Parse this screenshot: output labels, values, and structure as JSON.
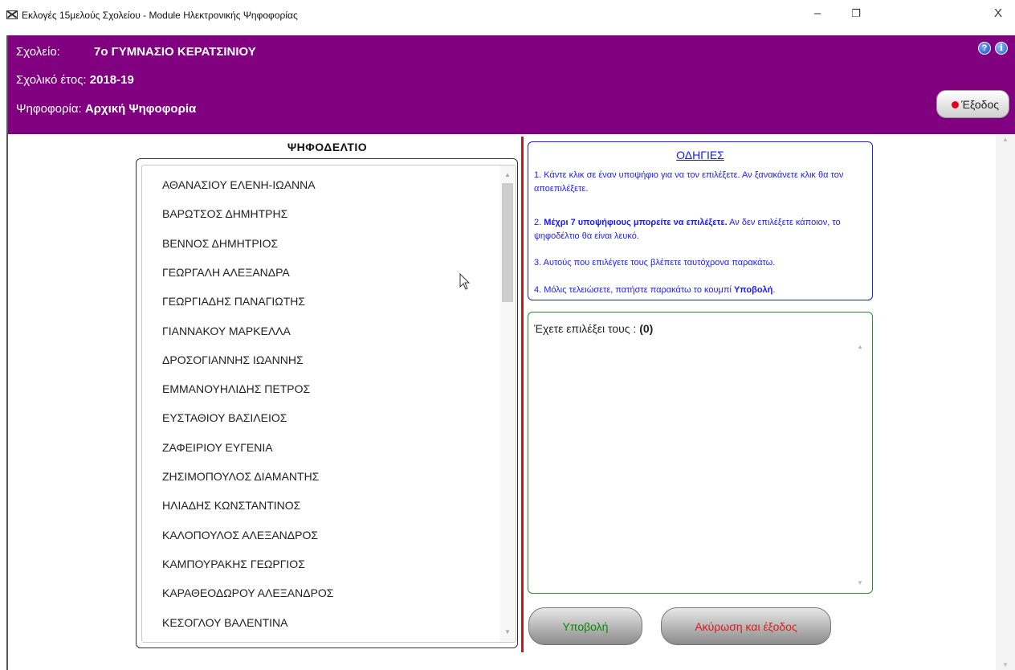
{
  "window": {
    "title": "Εκλογές 15μελούς Σχολείου - Module Ηλεκτρονικής Ψηφοφορίας",
    "minimize": "–",
    "maximize": "❐",
    "close": "X"
  },
  "header": {
    "school_label": "Σχολείο:",
    "school_value": "7ο ΓΥΜΝΑΣΙΟ ΚΕΡΑΤΣΙΝΙΟΥ",
    "year_label": "Σχολικό έτος:",
    "year_value": "2018-19",
    "vote_label": "Ψηφοφορία:",
    "vote_value": "Αρχική Ψηφοφορία",
    "help_glyph": "?",
    "info_glyph": "i",
    "exit_label": "Έξοδος",
    "background_color": "#800080"
  },
  "ballot": {
    "title": "ΨΗΦΟΔΕΛΤΙΟ",
    "candidates": [
      "ΑΘΑΝΑΣΙΟΥ ΕΛΕΝΗ-ΙΩΑΝΝΑ",
      "ΒΑΡΩΤΣΟΣ ΔΗΜΗΤΡΗΣ",
      "ΒΕΝΝΟΣ ΔΗΜΗΤΡΙΟΣ",
      "ΓΕΩΡΓΑΛΗ ΑΛΕΞΑΝΔΡΑ",
      "ΓΕΩΡΓΙΑΔΗΣ ΠΑΝΑΓΙΩΤΗΣ",
      "ΓΙΑΝΝΑΚΟΥ ΜΑΡΚΕΛΛΑ",
      "ΔΡΟΣΟΓΙΑΝΝΗΣ ΙΩΑΝΝΗΣ",
      "ΕΜΜΑΝΟΥΗΛΙΔΗΣ ΠΕΤΡΟΣ",
      "ΕΥΣΤΑΘΙΟΥ ΒΑΣΙΛΕΙΟΣ",
      "ΖΑΦΕΙΡΙΟΥ ΕΥΓΕΝΙΑ",
      "ΖΗΣΙΜΟΠΟΥΛΟΣ ΔΙΑΜΑΝΤΗΣ",
      "ΗΛΙΑΔΗΣ ΚΩΝΣΤΑΝΤΙΝΟΣ",
      "ΚΑΛΟΠΟΥΛΟΣ ΑΛΕΞΑΝΔΡΟΣ",
      "ΚΑΜΠΟΥΡΑΚΗΣ ΓΕΩΡΓΙΟΣ",
      "ΚΑΡΑΘΕΟΔΩΡΟΥ ΑΛΕΞΑΝΔΡΟΣ",
      "ΚΕΣΟΓΛΟΥ ΒΑΛΕΝΤΙΝΑ"
    ]
  },
  "instructions": {
    "title": "ΟΔΗΓΙΕΣ",
    "p1": "1. Κάντε κλικ σε έναν υποψήφιο για να τον επιλέξετε. Αν ξανακάνετε κλικ θα τον αποεπιλέξετε.",
    "p2_prefix": "2. ",
    "p2_bold": "Μέχρι 7 υποψήφιους μπορείτε να επιλέξετε.",
    "p2_rest": " Αν δεν επιλέξετε κάποιον, το ψηφοδέλτιο θα είναι λευκό.",
    "p3": "3. Αυτούς που επιλέγετε τους βλέπετε ταυτόχρονα παρακάτω.",
    "p4_prefix": "4. Μόλις τελειώσετε, πατήστε παρακάτω το κουμπί ",
    "p4_bold": "Υποβολή",
    "p4_suffix": ".",
    "color": "#1a1aff"
  },
  "selection": {
    "label": "Έχετε επιλέξει τους : ",
    "count": "(0)",
    "items": []
  },
  "buttons": {
    "submit": "Υποβολή",
    "cancel": "Ακύρωση και έξοδος"
  },
  "accent_colors": {
    "divider": "#b22222",
    "submit_text": "#0a8a0a",
    "cancel_text": "#e01b1b",
    "exit_dot": "#e0001c"
  }
}
